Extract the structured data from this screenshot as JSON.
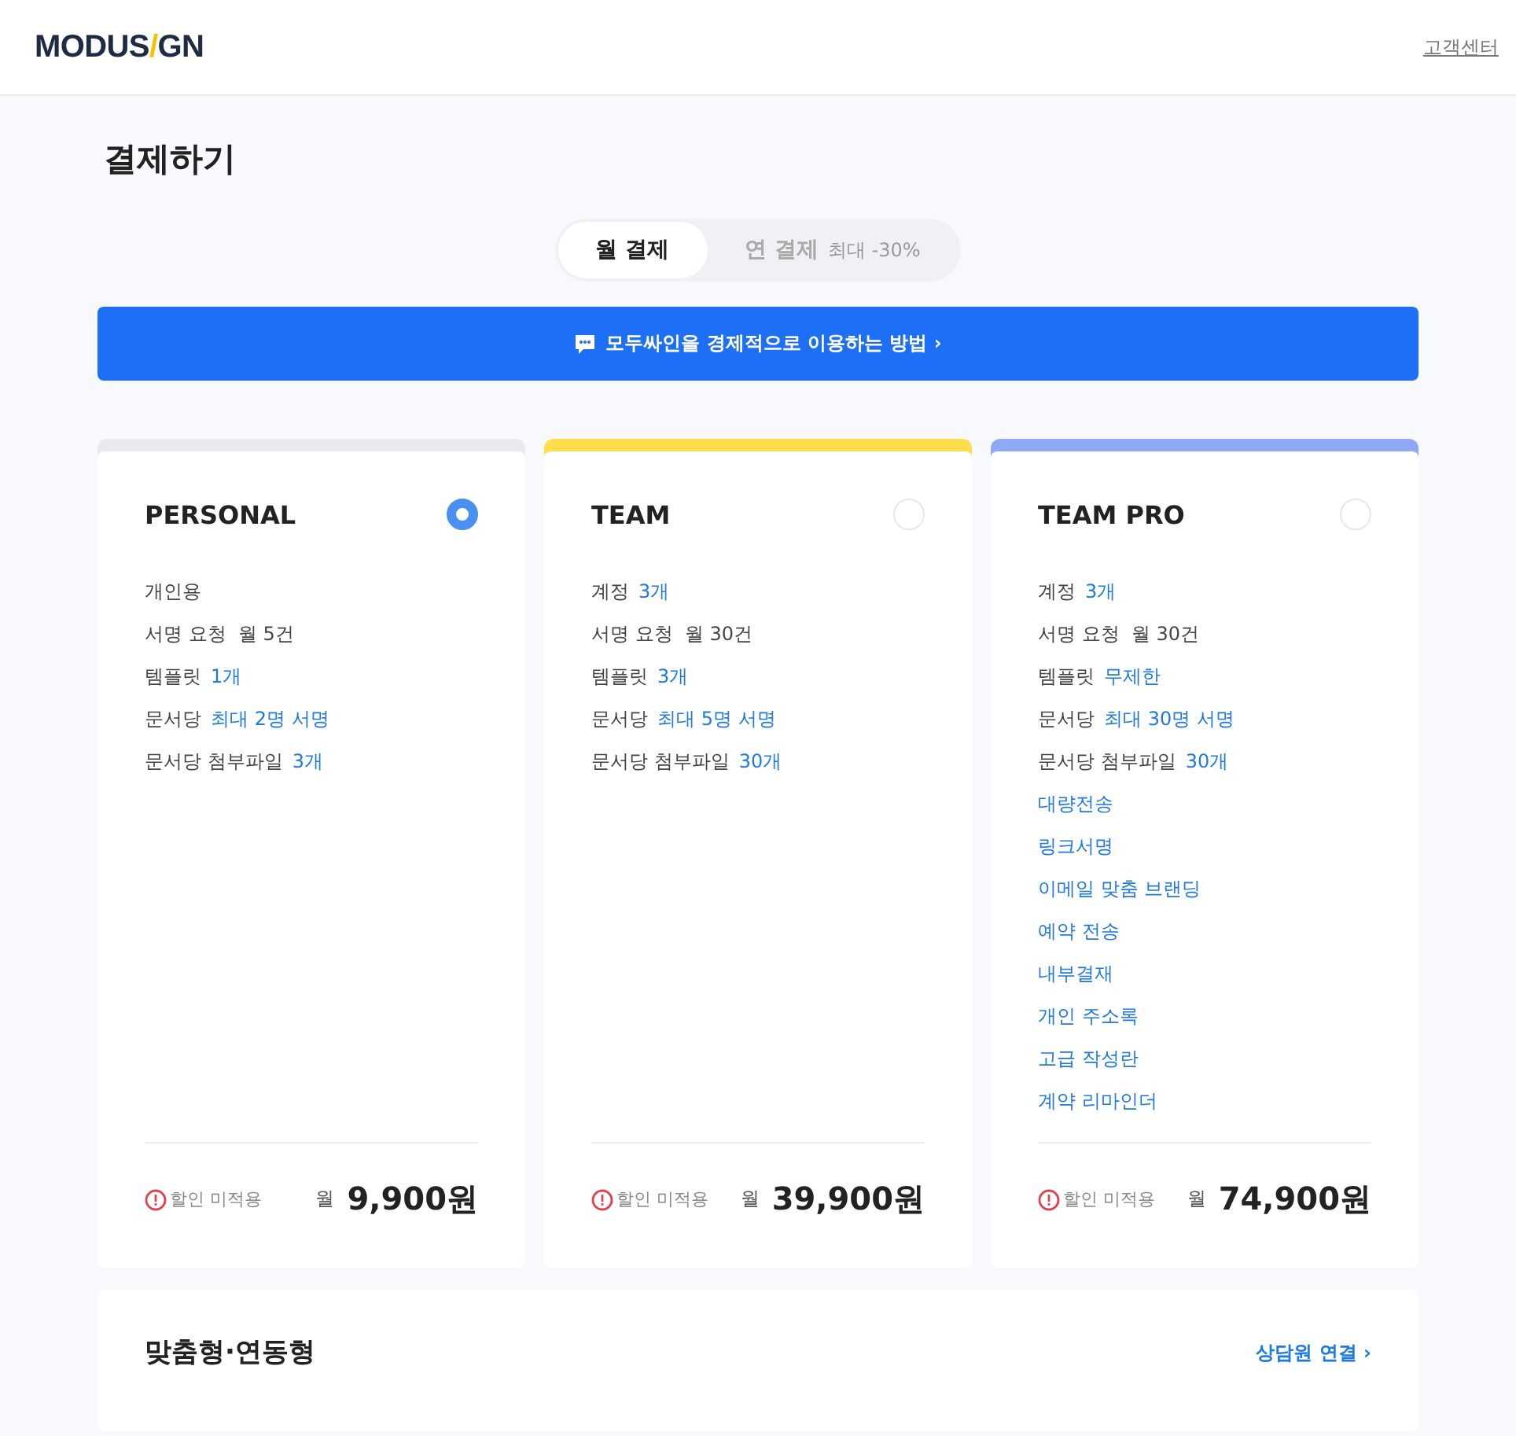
{
  "header": {
    "logo_left": "MODUS",
    "logo_slash": "/",
    "logo_right": "GN",
    "support_link": "고객센터"
  },
  "page_title": "결제하기",
  "billing_tabs": [
    {
      "label": "월 결제",
      "selected": true
    },
    {
      "label": "연 결제",
      "note": "최대 -30%",
      "selected": false
    }
  ],
  "banner": {
    "text": "모두싸인을 경제적으로 이용하는 방법",
    "chevron": "›"
  },
  "plans": [
    {
      "name": "PERSONAL",
      "color": "#e9eaee",
      "selected": true,
      "features": [
        {
          "label": "개인용"
        },
        {
          "label": "서명 요청  월 5건"
        },
        {
          "label": "템플릿",
          "detail": "1개"
        },
        {
          "label": "문서당",
          "detail": "최대 2명 서명"
        },
        {
          "label": "문서당 첨부파일",
          "detail": "3개"
        }
      ],
      "discount_note": "할인 미적용",
      "period": "월",
      "price": "9,900원"
    },
    {
      "name": "TEAM",
      "color": "#ffdd4d",
      "selected": false,
      "features": [
        {
          "label": "계정",
          "detail": "3개"
        },
        {
          "label": "서명 요청  월 30건"
        },
        {
          "label": "템플릿",
          "detail": "3개"
        },
        {
          "label": "문서당",
          "detail": "최대 5명 서명"
        },
        {
          "label": "문서당 첨부파일",
          "detail": "30개"
        }
      ],
      "discount_note": "할인 미적용",
      "period": "월",
      "price": "39,900원"
    },
    {
      "name": "TEAM PRO",
      "color": "#8fa9f5",
      "selected": false,
      "features": [
        {
          "label": "계정",
          "detail": "3개"
        },
        {
          "label": "서명 요청  월 30건"
        },
        {
          "label": "템플릿",
          "detail": "무제한"
        },
        {
          "label": "문서당",
          "detail": "최대 30명 서명"
        },
        {
          "label": "문서당 첨부파일",
          "detail": "30개"
        },
        {
          "detail": "대량전송"
        },
        {
          "detail": "링크서명"
        },
        {
          "detail": "이메일 맞춤 브랜딩"
        },
        {
          "detail": "예약 전송"
        },
        {
          "detail": "내부결재"
        },
        {
          "detail": "개인 주소록"
        },
        {
          "detail": "고급 작성란"
        },
        {
          "detail": "계약 리마인더"
        }
      ],
      "discount_note": "할인 미적용",
      "period": "월",
      "price": "74,900원"
    }
  ],
  "custom_plan": {
    "title": "맞춤형·연동형",
    "link": "상담원 연결",
    "chevron": "›"
  }
}
